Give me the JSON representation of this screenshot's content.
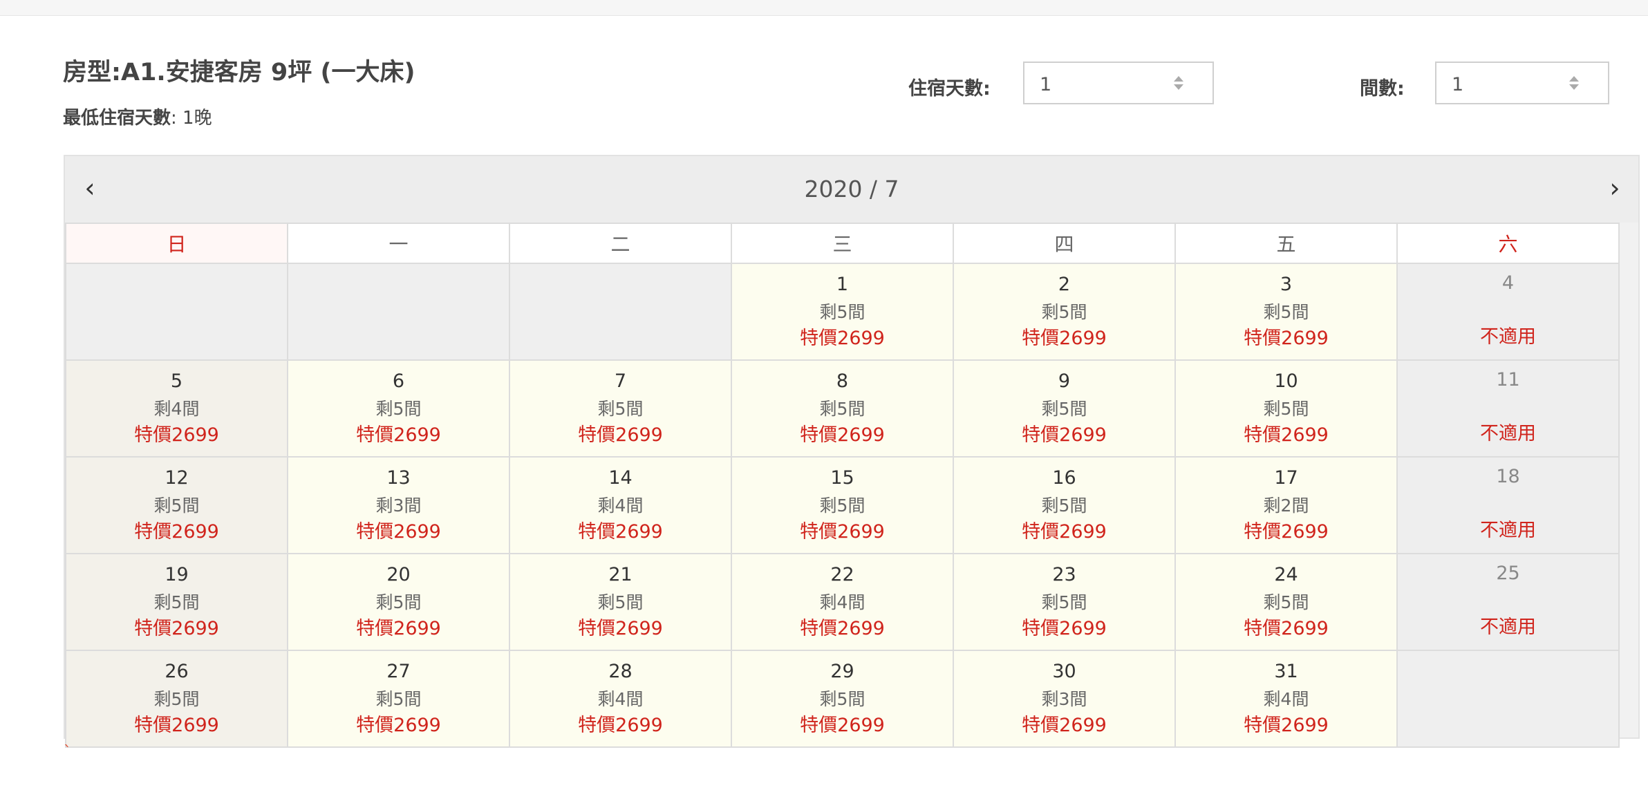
{
  "room": {
    "title": "房型:A1.安捷客房 9坪 (一大床)",
    "min_stay_label": "最低住宿天數",
    "min_stay_value": ": 1晚"
  },
  "controls": {
    "nights_label": "住宿天數:",
    "nights_value": "1",
    "rooms_label": "間數:",
    "rooms_value": "1"
  },
  "calendar": {
    "title": "2020 / 7",
    "prev_icon": "‹",
    "next_icon": "›",
    "weekdays": [
      "日",
      "一",
      "二",
      "三",
      "四",
      "五",
      "六"
    ],
    "weeks": [
      [
        {
          "empty": true
        },
        {
          "empty": true
        },
        {
          "empty": true
        },
        {
          "day": "1",
          "rooms": "剩5間",
          "price": "特價2699"
        },
        {
          "day": "2",
          "rooms": "剩5間",
          "price": "特價2699"
        },
        {
          "day": "3",
          "rooms": "剩5間",
          "price": "特價2699"
        },
        {
          "day": "4",
          "na": true,
          "price": "不適用"
        }
      ],
      [
        {
          "day": "5",
          "rooms": "剩4間",
          "price": "特價2699"
        },
        {
          "day": "6",
          "rooms": "剩5間",
          "price": "特價2699"
        },
        {
          "day": "7",
          "rooms": "剩5間",
          "price": "特價2699"
        },
        {
          "day": "8",
          "rooms": "剩5間",
          "price": "特價2699"
        },
        {
          "day": "9",
          "rooms": "剩5間",
          "price": "特價2699"
        },
        {
          "day": "10",
          "rooms": "剩5間",
          "price": "特價2699"
        },
        {
          "day": "11",
          "na": true,
          "price": "不適用"
        }
      ],
      [
        {
          "day": "12",
          "rooms": "剩5間",
          "price": "特價2699"
        },
        {
          "day": "13",
          "rooms": "剩3間",
          "price": "特價2699"
        },
        {
          "day": "14",
          "rooms": "剩4間",
          "price": "特價2699"
        },
        {
          "day": "15",
          "rooms": "剩5間",
          "price": "特價2699"
        },
        {
          "day": "16",
          "rooms": "剩5間",
          "price": "特價2699"
        },
        {
          "day": "17",
          "rooms": "剩2間",
          "price": "特價2699"
        },
        {
          "day": "18",
          "na": true,
          "price": "不適用"
        }
      ],
      [
        {
          "day": "19",
          "rooms": "剩5間",
          "price": "特價2699"
        },
        {
          "day": "20",
          "rooms": "剩5間",
          "price": "特價2699"
        },
        {
          "day": "21",
          "rooms": "剩5間",
          "price": "特價2699"
        },
        {
          "day": "22",
          "rooms": "剩4間",
          "price": "特價2699"
        },
        {
          "day": "23",
          "rooms": "剩5間",
          "price": "特價2699"
        },
        {
          "day": "24",
          "rooms": "剩5間",
          "price": "特價2699"
        },
        {
          "day": "25",
          "na": true,
          "price": "不適用"
        }
      ],
      [
        {
          "day": "26",
          "rooms": "剩5間",
          "price": "特價2699"
        },
        {
          "day": "27",
          "rooms": "剩5間",
          "price": "特價2699"
        },
        {
          "day": "28",
          "rooms": "剩4間",
          "price": "特價2699"
        },
        {
          "day": "29",
          "rooms": "剩5間",
          "price": "特價2699"
        },
        {
          "day": "30",
          "rooms": "剩3間",
          "price": "特價2699"
        },
        {
          "day": "31",
          "rooms": "剩4間",
          "price": "特價2699"
        },
        {
          "empty": true
        }
      ]
    ]
  },
  "footer_mark": "`",
  "colors": {
    "accent_red": "#d0241c",
    "available_bg": "#fdfdef",
    "unavailable_bg": "#eeeeee"
  }
}
